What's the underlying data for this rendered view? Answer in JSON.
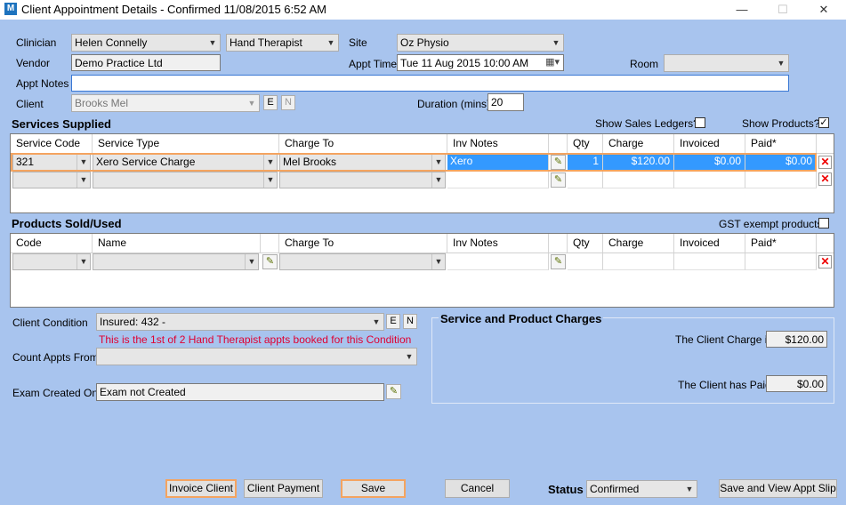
{
  "window": {
    "title": "Client Appointment Details - Confirmed 11/08/2015 6:52 AM",
    "app_icon": "M",
    "minimize": "—",
    "maximize": "☐",
    "close": "✕"
  },
  "form": {
    "clinician_label": "Clinician",
    "clinician_value": "Helen Connelly",
    "therapist_type": "Hand Therapist",
    "site_label": "Site",
    "site_value": "Oz Physio",
    "vendor_label": "Vendor",
    "vendor_value": "Demo Practice Ltd",
    "appt_time_label": "Appt Time",
    "appt_time_value": "Tue  11 Aug  2015 10:00 AM",
    "room_label": "Room",
    "room_value": "",
    "appt_notes_label": "Appt Notes",
    "appt_notes_value": "",
    "client_label": "Client",
    "client_value": "Brooks Mel",
    "client_e": "E",
    "client_n": "N",
    "duration_label": "Duration (mins)",
    "duration_value": "20"
  },
  "services": {
    "title": "Services Supplied",
    "show_sales_ledgers_label": "Show Sales Ledgers?",
    "show_sales_ledgers_checked": false,
    "show_products_label": "Show Products?",
    "show_products_checked": true,
    "columns": [
      "Service Code",
      "Service Type",
      "Charge To",
      "Inv Notes",
      "Qty",
      "Charge",
      "Invoiced",
      "Paid*"
    ],
    "rows": [
      {
        "code": "321",
        "type": "Xero Service Charge",
        "charge_to": "Mel Brooks",
        "inv_notes": "Xero",
        "qty": "1",
        "charge": "$120.00",
        "invoiced": "$0.00",
        "paid": "$0.00"
      },
      {
        "code": "",
        "type": "",
        "charge_to": "",
        "inv_notes": "",
        "qty": "",
        "charge": "",
        "invoiced": "",
        "paid": ""
      }
    ]
  },
  "products": {
    "title": "Products Sold/Used",
    "gst_label": "GST exempt products",
    "gst_checked": false,
    "columns": [
      "Code",
      "Name",
      "Charge To",
      "Inv Notes",
      "Qty",
      "Charge",
      "Invoiced",
      "Paid*"
    ]
  },
  "condition": {
    "client_condition_label": "Client Condition",
    "client_condition_value": "Insured: 432 -",
    "warning": "This is the 1st of 2 Hand Therapist appts booked for this Condition",
    "count_appts_label": "Count Appts From",
    "count_appts_value": "",
    "exam_label": "Exam Created On",
    "exam_value": "Exam not Created",
    "e": "E",
    "n": "N"
  },
  "charges": {
    "title": "Service and Product Charges",
    "client_charge_label": "The Client Charge is",
    "client_charge_value": "$120.00",
    "client_paid_label": "The Client has Paid",
    "client_paid_value": "$0.00"
  },
  "footer": {
    "invoice_client": "Invoice Client",
    "client_payment": "Client Payment",
    "save": "Save",
    "cancel": "Cancel",
    "status_label": "Status",
    "status_value": "Confirmed",
    "save_view": "Save and View Appt Slip"
  },
  "icons": {
    "pencil": "✎",
    "delete": "✕",
    "dropdown": "⌵",
    "calendar": "▦"
  }
}
